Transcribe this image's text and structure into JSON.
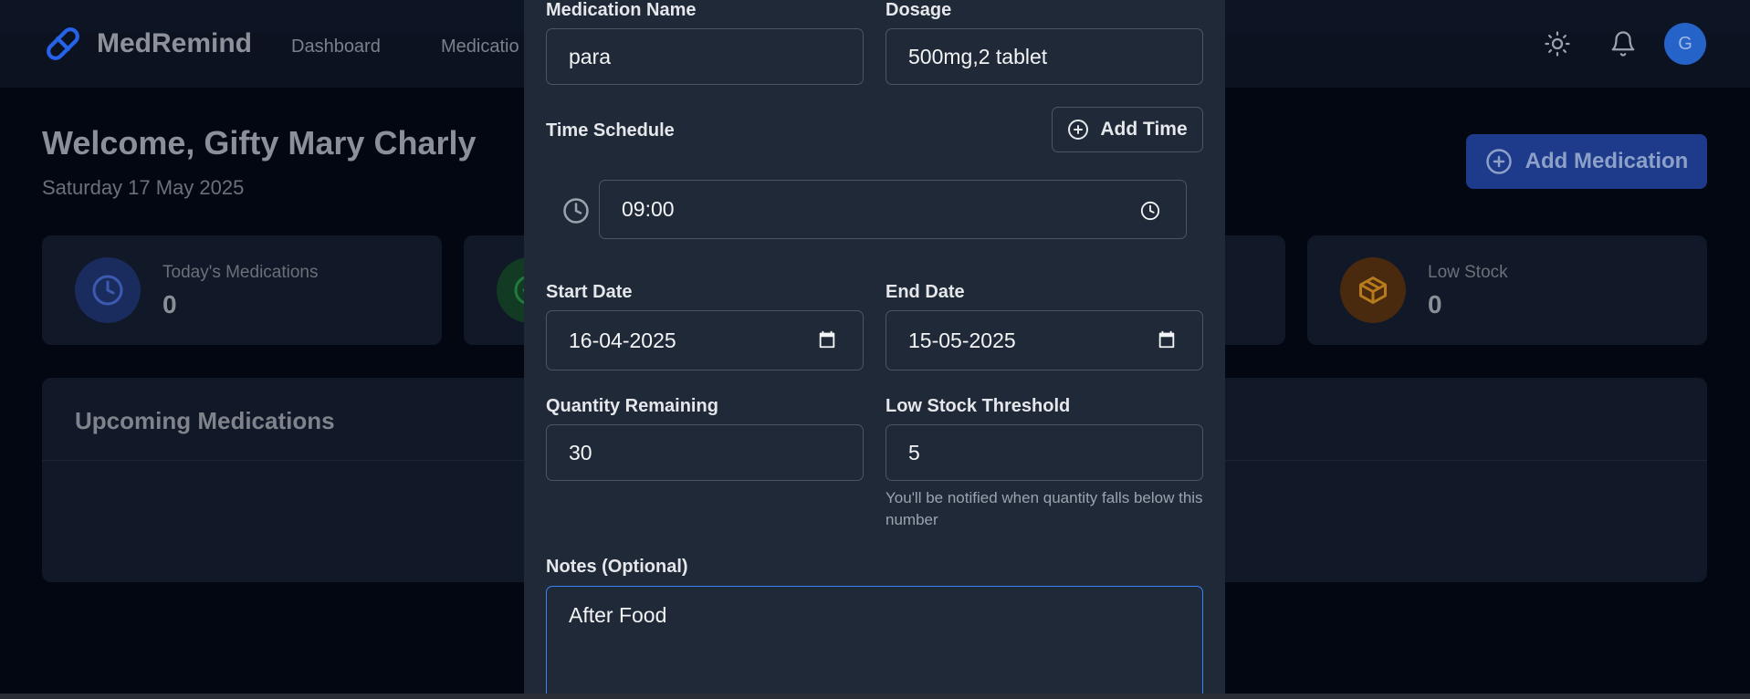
{
  "app": {
    "name": "MedRemind",
    "nav": [
      "Dashboard",
      "Medicatio"
    ],
    "avatar_initial": "G",
    "accent": "#2563eb"
  },
  "dashboard": {
    "welcome": "Welcome, Gifty Mary Charly",
    "date": "Saturday 17 May 2025",
    "add_button": "Add Medication",
    "stats": [
      {
        "label": "Today's Medications",
        "value": "0",
        "icon": "clock-icon",
        "color": "#1e3a8a"
      },
      {
        "label": "",
        "value": "",
        "icon": "check-circle-icon",
        "color": "#14532d"
      },
      {
        "label": "Low Stock",
        "value": "0",
        "icon": "package-icon",
        "color": "#78350f"
      }
    ],
    "upcoming_title": "Upcoming Medications"
  },
  "form": {
    "medication_name_label": "Medication Name",
    "medication_name_value": "para",
    "dosage_label": "Dosage",
    "dosage_value": "500mg,2 tablet",
    "time_schedule_label": "Time Schedule",
    "add_time_label": "Add Time",
    "time_value": "09:00",
    "start_date_label": "Start Date",
    "start_date_value": "16-04-2025",
    "end_date_label": "End Date",
    "end_date_value": "15-05-2025",
    "quantity_label": "Quantity Remaining",
    "quantity_value": "30",
    "threshold_label": "Low Stock Threshold",
    "threshold_value": "5",
    "threshold_hint": "You'll be notified when quantity falls below this number",
    "notes_label": "Notes (Optional)",
    "notes_value": "After Food"
  }
}
